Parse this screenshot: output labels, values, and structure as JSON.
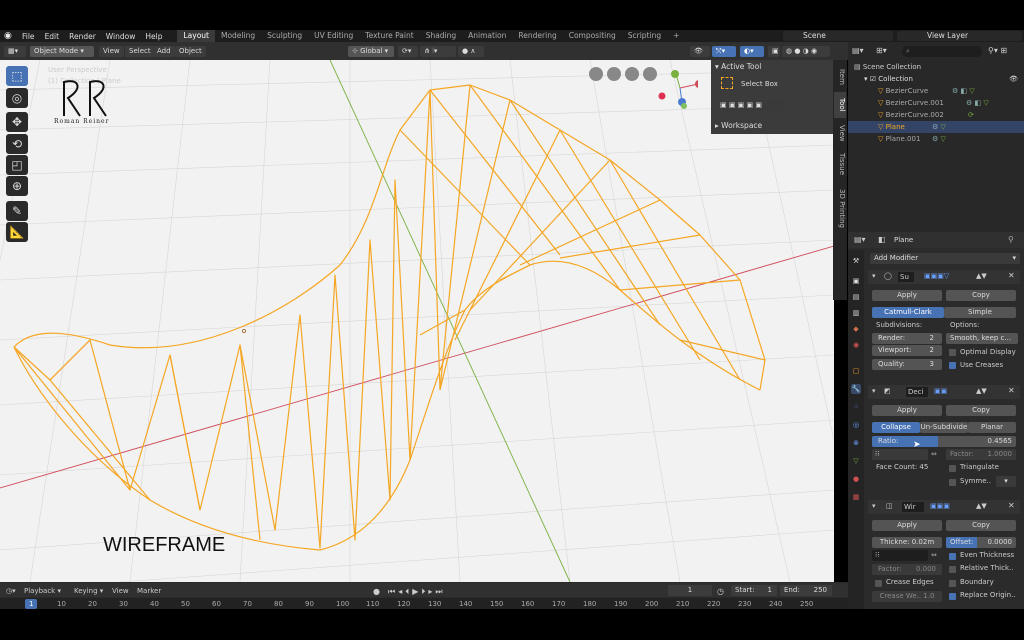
{
  "topmenu": {
    "menus": [
      "File",
      "Edit",
      "Render",
      "Window",
      "Help"
    ],
    "workspaces": [
      "Layout",
      "Modeling",
      "Sculpting",
      "UV Editing",
      "Texture Paint",
      "Shading",
      "Animation",
      "Rendering",
      "Compositing",
      "Scripting"
    ],
    "add_tab": "+",
    "scene": "Scene",
    "view_layer": "View Layer"
  },
  "viewport_header": {
    "mode": "Object Mode",
    "menus": [
      "View",
      "Select",
      "Add",
      "Object"
    ],
    "orientation": "Global"
  },
  "viewport": {
    "perspective": "User Perspective",
    "collection_info": "(1) Collection | Plane",
    "logo_signature": "Roman Reiner",
    "caption": "WIREFRAME",
    "axis_x_color": "#d04a5a",
    "axis_y_color": "#7ab040",
    "wire_color": "#f5a623"
  },
  "npanel": {
    "active_tool_label": "Active Tool",
    "select_box_label": "Select Box",
    "workspace_label": "Workspace",
    "tabs": [
      "Item",
      "Tool",
      "View",
      "Tissue",
      "3D Printing"
    ]
  },
  "outliner": {
    "search_placeholder": "",
    "scene_collection": "Scene Collection",
    "collection": "Collection",
    "items": [
      "BezierCurve",
      "BezierCurve.001",
      "BezierCurve.002",
      "Plane",
      "Plane.001"
    ]
  },
  "properties": {
    "object_name": "Plane",
    "add_modifier": "Add Modifier",
    "subsurf": {
      "name": "Su",
      "apply": "Apply",
      "copy": "Copy",
      "catmull": "Catmull-Clark",
      "simple": "Simple",
      "subdivisions_label": "Subdivisions:",
      "options_label": "Options:",
      "render_label": "Render:",
      "render_value": "2",
      "viewport_label": "Viewport:",
      "viewport_value": "2",
      "quality_label": "Quality:",
      "quality_value": "3",
      "smooth_option": "Smooth, keep c...",
      "optimal_display": "Optimal Display",
      "use_creases": "Use Creases"
    },
    "decimate": {
      "name": "Deci",
      "apply": "Apply",
      "copy": "Copy",
      "collapse": "Collapse",
      "unsubdivide": "Un-Subdivide",
      "planar": "Planar",
      "ratio_label": "Ratio:",
      "ratio_value": "0.4565",
      "ratio_fraction": 0.4565,
      "factor_label": "Factor:",
      "factor_value": "1.0000",
      "face_count": "Face Count: 45",
      "triangulate": "Triangulate",
      "symmetry": "Symme.."
    },
    "wireframe": {
      "name": "Wir",
      "apply": "Apply",
      "copy": "Copy",
      "thickness": "Thickne: 0.02m",
      "offset_label": "Offset:",
      "offset_value": "0.0000",
      "even_thickness": "Even Thickness",
      "relative_thickness": "Relative Thick..",
      "factor_label": "Factor:",
      "factor_value": "0.000",
      "boundary": "Boundary",
      "crease_edges": "Crease Edges",
      "crease_weight": "Crease We.. 1.0",
      "replace_original": "Replace Origin.."
    }
  },
  "timeline": {
    "menus": [
      "Playback",
      "Keying",
      "View",
      "Marker"
    ],
    "current_frame": "1",
    "start_label": "Start:",
    "start_value": "1",
    "end_label": "End:",
    "end_value": "250",
    "ruler": [
      "1",
      "10",
      "20",
      "30",
      "40",
      "50",
      "60",
      "70",
      "80",
      "90",
      "100",
      "110",
      "120",
      "130",
      "140",
      "150",
      "160",
      "170",
      "180",
      "190",
      "200",
      "210",
      "220",
      "230",
      "240",
      "250"
    ]
  }
}
